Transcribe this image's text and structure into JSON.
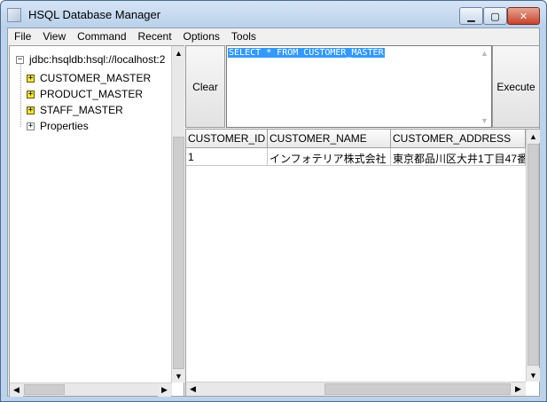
{
  "window": {
    "title": "HSQL Database Manager"
  },
  "window_controls": {
    "minimize": "▁",
    "maximize": "▢",
    "close": "✕"
  },
  "menu": [
    "File",
    "View",
    "Command",
    "Recent",
    "Options",
    "Tools"
  ],
  "tree": {
    "root": "jdbc:hsqldb:hsql://localhost:2",
    "items": [
      "CUSTOMER_MASTER",
      "PRODUCT_MASTER",
      "STAFF_MASTER",
      "Properties"
    ]
  },
  "buttons": {
    "clear": "Clear",
    "execute": "Execute"
  },
  "query": {
    "text": "SELECT * FROM CUSTOMER_MASTER"
  },
  "results": {
    "columns": [
      "CUSTOMER_ID",
      "CUSTOMER_NAME",
      "CUSTOMER_ADDRESS"
    ],
    "rows": [
      [
        "1",
        "インフォテリア株式会社",
        "東京都品川区大井1丁目47番"
      ]
    ]
  },
  "colors": {
    "selection": "#3399ff",
    "titlebar": "#bcd3ec"
  }
}
